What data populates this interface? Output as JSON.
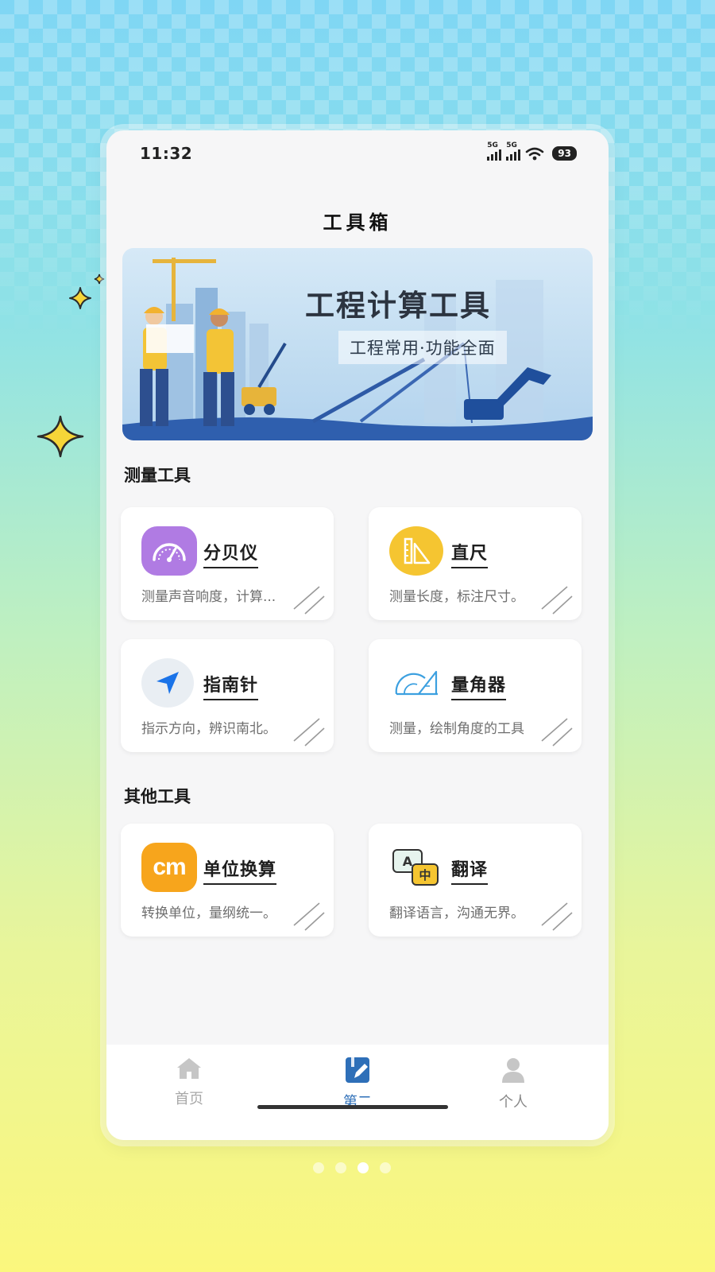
{
  "status_bar": {
    "time": "11:32",
    "signal_1": "5G",
    "signal_2": "5G",
    "battery": "93"
  },
  "page": {
    "title": "工具箱"
  },
  "banner": {
    "title": "工程计算工具",
    "subtitle": "工程常用·功能全面"
  },
  "sections": {
    "measure": {
      "title": "测量工具",
      "tools": [
        {
          "name": "分贝仪",
          "desc": "测量声音响度，计算...",
          "icon": "decibel-meter-icon",
          "color": "#b07be3"
        },
        {
          "name": "直尺",
          "desc": "测量长度，标注尺寸。",
          "icon": "ruler-icon",
          "color": "#f5c531"
        },
        {
          "name": "指南针",
          "desc": "指示方向，辨识南北。",
          "icon": "compass-arrow-icon",
          "color": "#1a73e8"
        },
        {
          "name": "量角器",
          "desc": "测量，绘制角度的工具",
          "icon": "protractor-icon",
          "color": "#3ca0e0"
        }
      ]
    },
    "other": {
      "title": "其他工具",
      "tools": [
        {
          "name": "单位换算",
          "desc": "转换单位，量纲统一。",
          "icon": "unit-conversion-icon",
          "icon_text": "cm",
          "color": "#f7a51c"
        },
        {
          "name": "翻译",
          "desc": "翻译语言，沟通无界。",
          "icon": "translate-icon",
          "icon_text_a": "A",
          "icon_text_b": "中",
          "color": "#f5c531"
        }
      ]
    }
  },
  "tabbar": {
    "tabs": [
      {
        "label": "首页",
        "icon": "home-icon",
        "active": false
      },
      {
        "label": "第二",
        "icon": "notebook-pen-icon",
        "active": true
      },
      {
        "label": "个人",
        "icon": "person-icon",
        "active": false
      }
    ],
    "active_color": "#2e6fb8",
    "inactive_color": "#a8a8a8"
  },
  "pager": {
    "count": 4,
    "active_index": 2
  }
}
